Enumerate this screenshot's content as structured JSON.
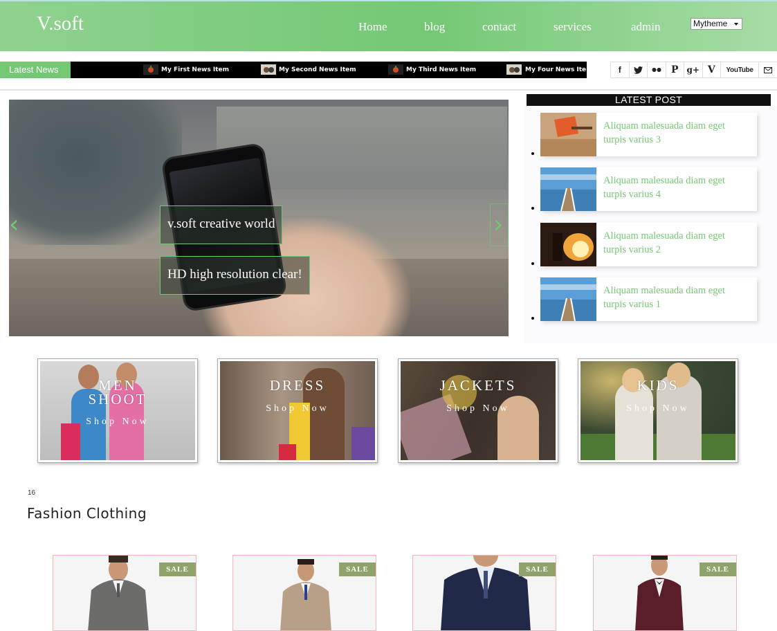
{
  "brand": {
    "logo": "V.soft",
    "accent": "#74c874"
  },
  "nav": {
    "items": [
      "Home",
      "blog",
      "contact",
      "services",
      "admin"
    ],
    "theme_select": "Mytheme"
  },
  "news": {
    "label": "Latest News",
    "items": [
      "My First News Item",
      "My Second News Item",
      "My Third News Item",
      "My Four News Ite"
    ]
  },
  "social": [
    "facebook-icon",
    "twitter-icon",
    "flickr-icon",
    "pinterest-icon",
    "google-plus-icon",
    "vimeo-icon",
    "youtube-icon",
    "mail-icon"
  ],
  "social_youtube_label": "YouTube",
  "slider": {
    "caption1": "v.soft creative world",
    "caption2": "HD high resolution clear!"
  },
  "latest_post": {
    "heading": "LATEST POST",
    "posts": [
      {
        "title": "Aliquam malesuada diam eget turpis varius 3"
      },
      {
        "title": "Aliquam malesuada diam eget turpis varius 4"
      },
      {
        "title": "Aliquam malesuada diam eget turpis varius 2"
      },
      {
        "title": "Aliquam malesuada diam eget turpis varius 1"
      }
    ]
  },
  "categories": [
    {
      "name_line1": "MEN",
      "name_line2": "SHOOT",
      "cta": "Shop Now"
    },
    {
      "name_line1": "DRESS",
      "name_line2": "",
      "cta": "Shop Now"
    },
    {
      "name_line1": "JACKETS",
      "name_line2": "",
      "cta": "Shop Now"
    },
    {
      "name_line1": "KIDS",
      "name_line2": "",
      "cta": "Shop Now"
    }
  ],
  "section": {
    "number": "16",
    "title": "Fashion Clothing"
  },
  "products": [
    {
      "badge": "SALE"
    },
    {
      "badge": "SALE"
    },
    {
      "badge": "SALE"
    },
    {
      "badge": "SALE"
    }
  ]
}
